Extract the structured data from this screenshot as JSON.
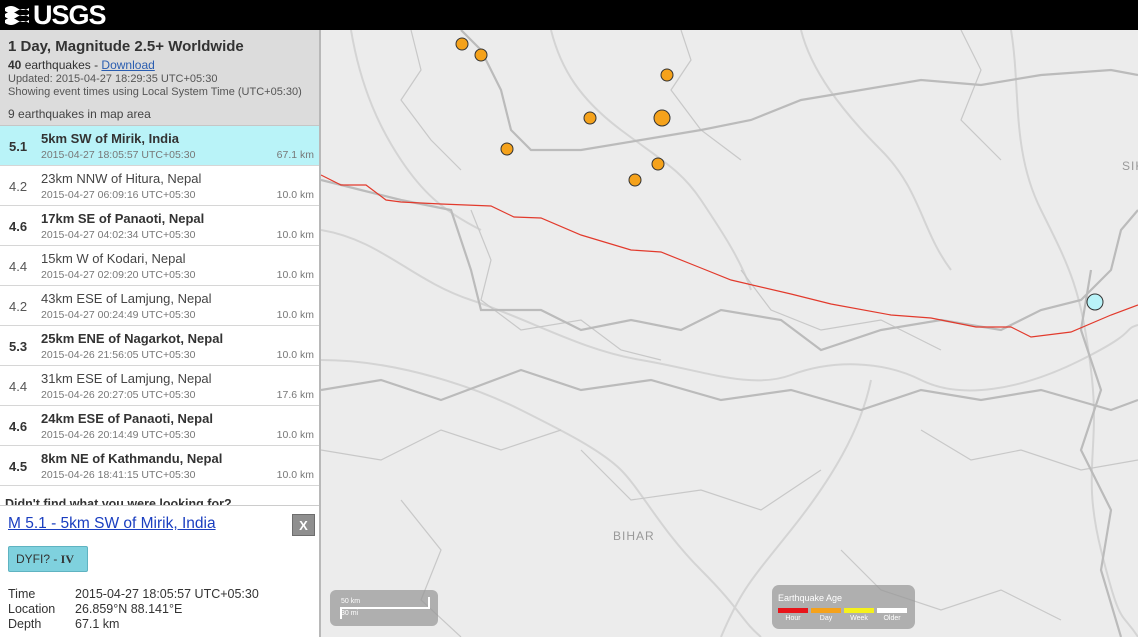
{
  "header": {
    "logo_text": "USGS"
  },
  "summary": {
    "title": "1 Day, Magnitude 2.5+ Worldwide",
    "count": "40",
    "count_suffix": "earthquakes - ",
    "download_label": "Download",
    "updated": "Updated: 2015-04-27 18:29:35 UTC+05:30",
    "timezone_note": "Showing event times using Local System Time (UTC+05:30)",
    "map_area_count": "9",
    "map_area_suffix": "earthquakes in map area"
  },
  "earthquakes": [
    {
      "mag": "5.1",
      "place": "5km SW of Mirik, India",
      "time": "2015-04-27 18:05:57 UTC+05:30",
      "depth": "67.1 km",
      "bold": true,
      "selected": true
    },
    {
      "mag": "4.2",
      "place": "23km NNW of Hitura, Nepal",
      "time": "2015-04-27 06:09:16 UTC+05:30",
      "depth": "10.0 km",
      "bold": false,
      "selected": false
    },
    {
      "mag": "4.6",
      "place": "17km SE of Panaoti, Nepal",
      "time": "2015-04-27 04:02:34 UTC+05:30",
      "depth": "10.0 km",
      "bold": true,
      "selected": false
    },
    {
      "mag": "4.4",
      "place": "15km W of Kodari, Nepal",
      "time": "2015-04-27 02:09:20 UTC+05:30",
      "depth": "10.0 km",
      "bold": false,
      "selected": false
    },
    {
      "mag": "4.2",
      "place": "43km ESE of Lamjung, Nepal",
      "time": "2015-04-27 00:24:49 UTC+05:30",
      "depth": "10.0 km",
      "bold": false,
      "selected": false
    },
    {
      "mag": "5.3",
      "place": "25km ENE of Nagarkot, Nepal",
      "time": "2015-04-26 21:56:05 UTC+05:30",
      "depth": "10.0 km",
      "bold": true,
      "selected": false
    },
    {
      "mag": "4.4",
      "place": "31km ESE of Lamjung, Nepal",
      "time": "2015-04-26 20:27:05 UTC+05:30",
      "depth": "17.6 km",
      "bold": false,
      "selected": false
    },
    {
      "mag": "4.6",
      "place": "24km ESE of Panaoti, Nepal",
      "time": "2015-04-26 20:14:49 UTC+05:30",
      "depth": "10.0 km",
      "bold": true,
      "selected": false
    },
    {
      "mag": "4.5",
      "place": "8km NE of Kathmandu, Nepal",
      "time": "2015-04-26 18:41:15 UTC+05:30",
      "depth": "10.0 km",
      "bold": true,
      "selected": false
    }
  ],
  "didnt_find": "Didn't find what you were looking for?",
  "detail": {
    "title": "M 5.1 - 5km SW of Mirik, India",
    "close_label": "X",
    "dyfi_label": "DYFI? - ",
    "dyfi_intensity": "IV",
    "rows": [
      {
        "key": "Time",
        "value": "2015-04-27 18:05:57 UTC+05:30"
      },
      {
        "key": "Location",
        "value": "26.859°N 88.141°E"
      },
      {
        "key": "Depth",
        "value": "67.1 km"
      }
    ]
  },
  "map": {
    "labels": {
      "bihar": "BIHAR",
      "sikkim_partial": "SIK"
    },
    "scale": {
      "km": "50 km",
      "mi": "30 mi"
    },
    "legend": {
      "title": "Earthquake Age",
      "items": [
        {
          "label": "Hour",
          "color": "#e8141a"
        },
        {
          "label": "Day",
          "color": "#f5a21b"
        },
        {
          "label": "Week",
          "color": "#f5f11b"
        },
        {
          "label": "Older",
          "color": "#ffffff"
        }
      ]
    },
    "colors": {
      "day_marker": "#f5a21b",
      "selected_marker": "#b9f3f8",
      "border_line": "#e23a2c"
    }
  }
}
